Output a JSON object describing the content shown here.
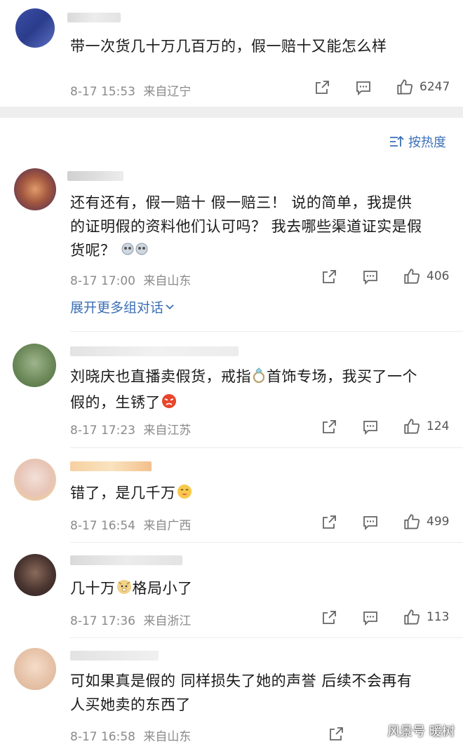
{
  "top_comment": {
    "text": "带一次货几十万几百万的，假一赔十又能怎么样",
    "date": "8-17 15:53",
    "location": "来自辽宁",
    "likes": "6247"
  },
  "sort": {
    "label": "按热度"
  },
  "comments": [
    {
      "lines": [
        "还有还有，假一赔十  假一赔三！ 说的简单，我提供",
        "的证明假的资料他们认可吗？ 我去哪些渠道证实是假",
        "货呢？"
      ],
      "date": "8-17 17:00",
      "location": "来自山东",
      "likes": "406",
      "expand": "展开更多组对话"
    },
    {
      "lines_a": "刘晓庆也直播卖假货，戒指",
      "lines_b": "首饰专场，我买了一个",
      "line2": "假的，生锈了",
      "date": "8-17 17:23",
      "location": "来自江苏",
      "likes": "124"
    },
    {
      "text": "错了，是几千万",
      "date": "8-17 16:54",
      "location": "来自广西",
      "likes": "499"
    },
    {
      "text_a": "几十万",
      "text_b": "格局小了",
      "date": "8-17 17:36",
      "location": "来自浙江",
      "likes": "113"
    },
    {
      "lines": [
        "可如果真是假的 同样损失了她的声誉 后续不会再有",
        "人买她卖的东西了"
      ],
      "date": "8-17 16:58",
      "location": "来自山东"
    }
  ],
  "watermark": "风景号 暖树",
  "colors": {
    "link": "#3b6fb6",
    "meta": "#8a8a8a",
    "separator": "#eeeeee"
  }
}
